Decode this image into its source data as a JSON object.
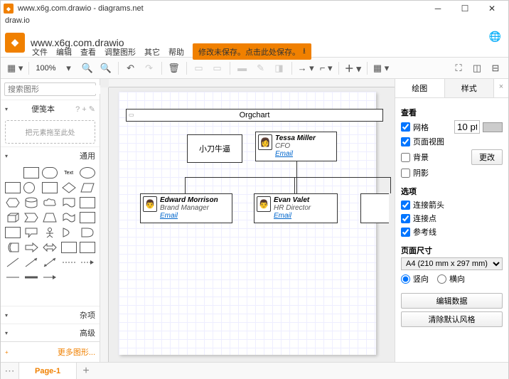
{
  "window": {
    "title": "www.x6g.com.drawio - diagrams.net",
    "subtitle": "draw.io"
  },
  "header": {
    "filename": "www.x6g.com.drawio"
  },
  "menu": {
    "items": [
      "文件",
      "编辑",
      "查看",
      "调整图形",
      "其它",
      "帮助"
    ],
    "save_banner": "修改未保存。点击此处保存。"
  },
  "toolbar": {
    "zoom": "100%"
  },
  "left": {
    "search_placeholder": "搜索图形",
    "scratchpad": "便笺本",
    "dropzone": "把元素拖至此处",
    "general": "通用",
    "misc": "杂项",
    "advanced": "高级",
    "more": "更多图形..."
  },
  "canvas": {
    "container_title": "Orgchart",
    "box1": {
      "text": "小刀牛逼"
    },
    "card_top": {
      "name": "Tessa Miller",
      "role": "CFO",
      "email": "Email"
    },
    "card_left": {
      "name": "Edward Morrison",
      "role": "Brand Manager",
      "email": "Email"
    },
    "card_right": {
      "name": "Evan Valet",
      "role": "HR Director",
      "email": "Email"
    }
  },
  "right": {
    "tabs": {
      "diagram": "绘图",
      "style": "样式"
    },
    "view": {
      "heading": "查看",
      "grid": "网格",
      "grid_size": "10 pt",
      "pageview": "页面视图",
      "background": "背景",
      "change": "更改",
      "shadow": "阴影"
    },
    "options": {
      "heading": "选项",
      "connarrows": "连接箭头",
      "connpoints": "连接点",
      "guides": "参考线"
    },
    "pagesize": {
      "heading": "页面尺寸",
      "value": "A4 (210 mm x 297 mm)",
      "portrait": "竖向",
      "landscape": "横向"
    },
    "buttons": {
      "editdata": "编辑数据",
      "clearstyle": "清除默认风格"
    }
  },
  "footer": {
    "page": "Page-1"
  }
}
